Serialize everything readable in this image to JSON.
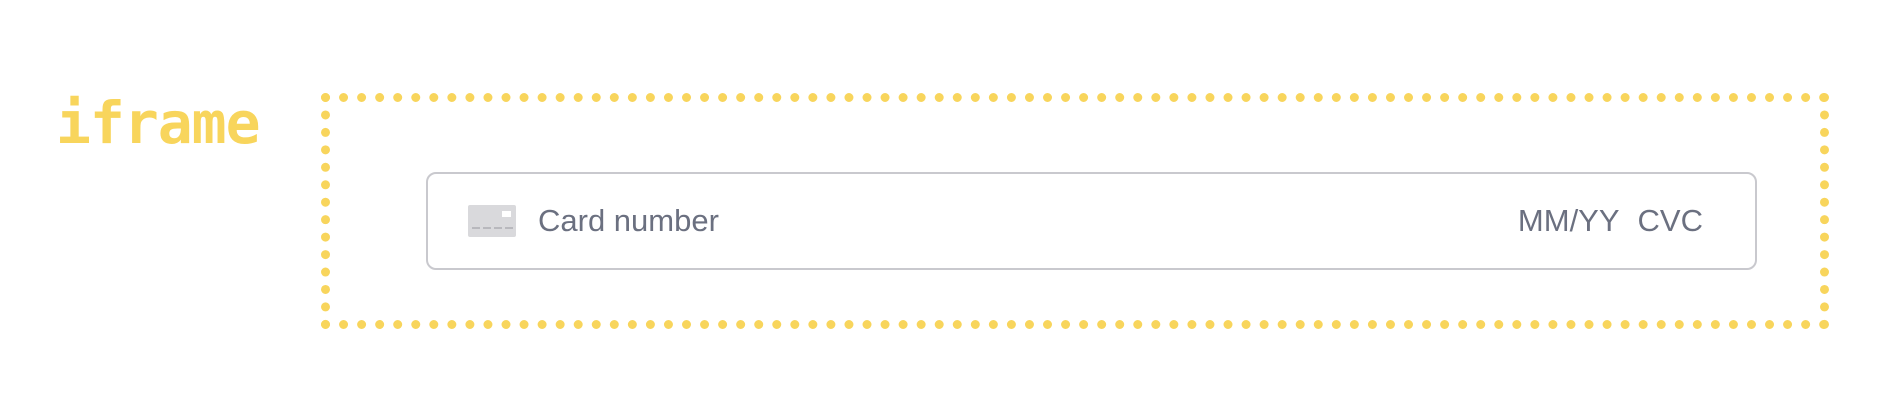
{
  "label": {
    "text": "iframe"
  },
  "card_input": {
    "icon": "credit-card-icon",
    "card_number_placeholder": "Card number",
    "expiry_placeholder": "MM/YY",
    "cvc_placeholder": "CVC"
  },
  "colors": {
    "accent": "#f8d55c",
    "placeholder": "#6b7080",
    "border": "#c9c9ce",
    "icon": "#d9d9dc"
  }
}
